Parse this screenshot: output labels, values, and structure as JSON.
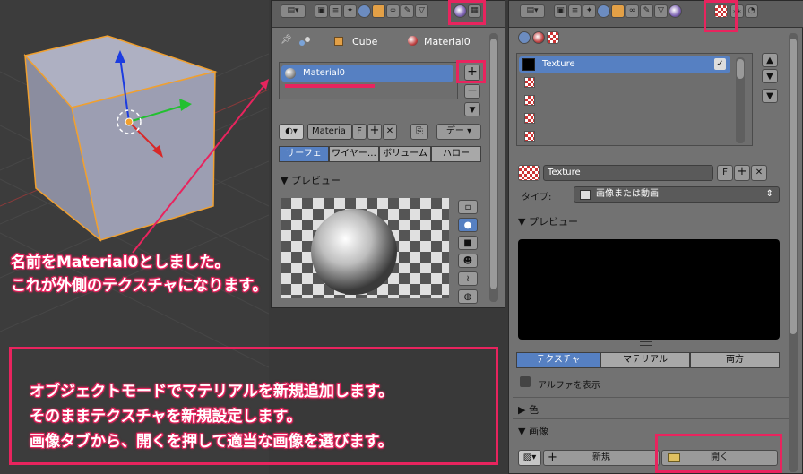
{
  "annotations": {
    "top_line1": "名前をMaterial0としました。",
    "top_line2": "これが外側のテクスチャになります。",
    "box_line1": "オブジェクトモードでマテリアルを新規追加します。",
    "box_line2": "そのままテクスチャを新規設定します。",
    "box_line3": "画像タブから、開くを押して適当な画像を選びます。",
    "color": "#e8245e"
  },
  "material_panel": {
    "breadcrumb": {
      "object": "Cube",
      "material": "Material0"
    },
    "slot_name": "Material0",
    "material_field": "Materia",
    "fake_user": "F",
    "dropdown": "デー",
    "tabs": [
      "サーフェ",
      "ワイヤー…",
      "ボリューム",
      "ハロー"
    ],
    "active_tab": 0,
    "preview_label": "▼ プレビュー"
  },
  "texture_panel": {
    "slot_name": "Texture",
    "texture_field": "Texture",
    "fake_user": "F",
    "type_label": "タイプ:",
    "type_value": "画像または動画",
    "preview_label": "▼ プレビュー",
    "tabs": [
      "テクスチャ",
      "マテリアル",
      "両方"
    ],
    "active_tab": 0,
    "alpha_label": "アルファを表示",
    "color_label": "▶ 色",
    "image_label": "▼ 画像",
    "new_label": "新規",
    "open_label": "開く"
  }
}
